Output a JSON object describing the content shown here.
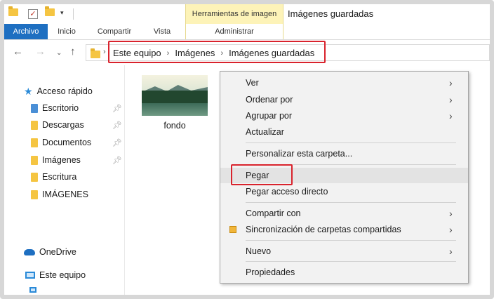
{
  "window": {
    "title": "Imágenes guardadas"
  },
  "ribbon": {
    "context_group": "Herramientas de imagen",
    "tabs": {
      "archivo": "Archivo",
      "inicio": "Inicio",
      "compartir": "Compartir",
      "vista": "Vista",
      "administrar": "Administrar"
    }
  },
  "address": {
    "crumbs": [
      "Este equipo",
      "Imágenes",
      "Imágenes guardadas"
    ]
  },
  "sidebar": {
    "quick_access": "Acceso rápido",
    "items": [
      {
        "label": "Escritorio",
        "pinned": true
      },
      {
        "label": "Descargas",
        "pinned": true
      },
      {
        "label": "Documentos",
        "pinned": true
      },
      {
        "label": "Imágenes",
        "pinned": true
      },
      {
        "label": "Escritura",
        "pinned": false
      },
      {
        "label": "IMÁGENES",
        "pinned": false
      }
    ],
    "onedrive": "OneDrive",
    "this_pc": "Este equipo"
  },
  "content": {
    "files": [
      {
        "name": "fondo",
        "icon": "image-thumbnail"
      }
    ]
  },
  "context_menu": {
    "items": {
      "ver": "Ver",
      "ordenar": "Ordenar por",
      "agrupar": "Agrupar por",
      "actualizar": "Actualizar",
      "personalizar": "Personalizar esta carpeta...",
      "pegar": "Pegar",
      "pegar_acceso": "Pegar acceso directo",
      "compartir_con": "Compartir con",
      "sincronizacion": "Sincronización de carpetas compartidas",
      "nuevo": "Nuevo",
      "propiedades": "Propiedades"
    }
  },
  "colors": {
    "accent": "#1e6fc1",
    "highlight_box": "#d9232d",
    "context_tab": "#fdf3b8"
  }
}
